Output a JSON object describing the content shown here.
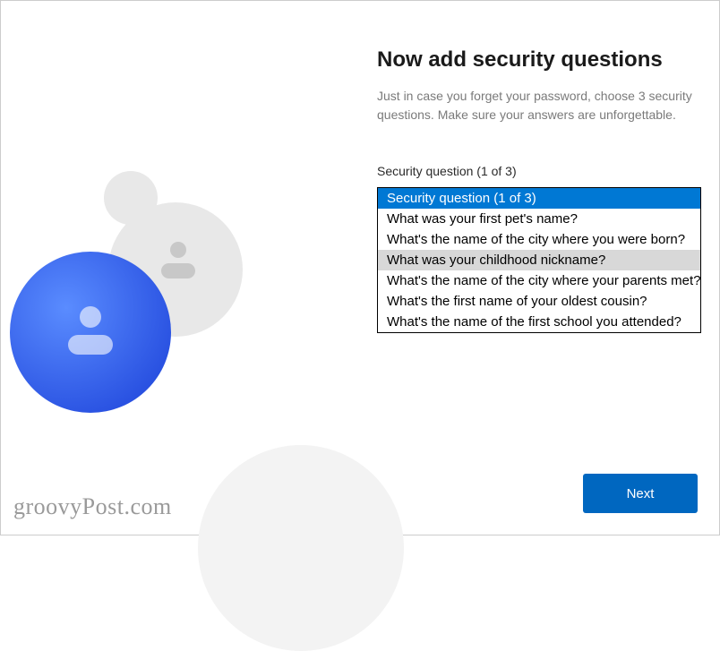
{
  "title": "Now add security questions",
  "subtitle": "Just in case you forget your password, choose 3 security questions. Make sure your answers are unforgettable.",
  "section_label": "Security question (1 of 3)",
  "dropdown": {
    "options": [
      "Security question (1 of 3)",
      "What was your first pet's name?",
      "What's the name of the city where you were born?",
      "What was your childhood nickname?",
      "What's the name of the city where your parents met?",
      "What's the first name of your oldest cousin?",
      "What's the name of the first school you attended?"
    ],
    "selected_index": 0,
    "hovered_index": 3
  },
  "next_button": "Next",
  "watermark": "groovyPost.com"
}
